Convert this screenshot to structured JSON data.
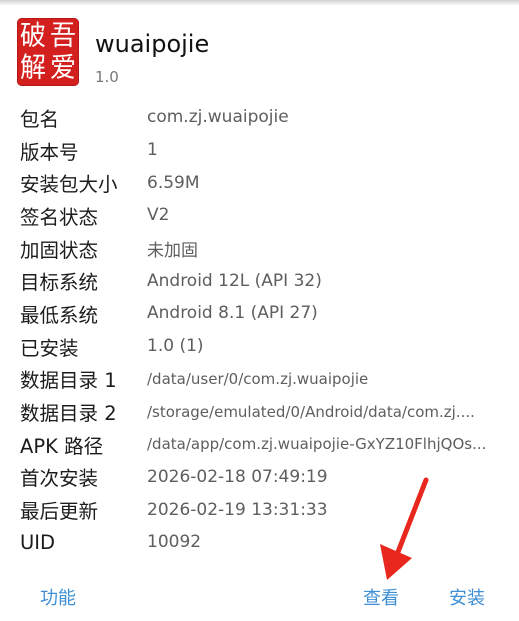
{
  "app": {
    "logo_chars": [
      "破",
      "吾",
      "解",
      "爱"
    ],
    "name": "wuaipojie",
    "version": "1.0"
  },
  "details": [
    {
      "label": "包名",
      "value": "com.zj.wuaipojie"
    },
    {
      "label": "版本号",
      "value": "1"
    },
    {
      "label": "安装包大小",
      "value": "6.59M"
    },
    {
      "label": "签名状态",
      "value": "V2"
    },
    {
      "label": "加固状态",
      "value": "未加固"
    },
    {
      "label": "目标系统",
      "value": "Android 12L (API 32)"
    },
    {
      "label": "最低系统",
      "value": "Android 8.1 (API 27)"
    },
    {
      "label": "已安装",
      "value": "1.0 (1)"
    },
    {
      "label": "数据目录 1",
      "value": "/data/user/0/com.zj.wuaipojie"
    },
    {
      "label": "数据目录 2",
      "value": "/storage/emulated/0/Android/data/com.zj...."
    },
    {
      "label": "APK 路径",
      "value": "/data/app/com.zj.wuaipojie-GxYZ10FlhjQOs..."
    },
    {
      "label": "首次安装",
      "value": "2026-02-18 07:49:19"
    },
    {
      "label": "最后更新",
      "value": "2026-02-19 13:31:33"
    },
    {
      "label": "UID",
      "value": "10092"
    }
  ],
  "actions": {
    "function_label": "功能",
    "view_label": "查看",
    "install_label": "安装"
  },
  "colors": {
    "logo_red": "#d3201e",
    "action_blue": "#3e8fd6",
    "arrow_red": "#e8281e"
  }
}
